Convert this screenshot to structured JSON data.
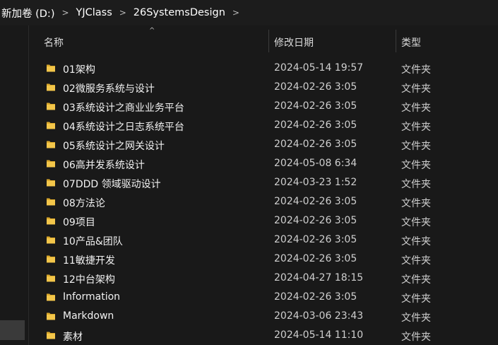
{
  "breadcrumb": {
    "items": [
      "新加卷 (D:)",
      "YJClass",
      "26SystemsDesign"
    ],
    "separator": ">"
  },
  "columns": {
    "name": "名称",
    "date": "修改日期",
    "type": "类型",
    "sort_indicator": "^"
  },
  "colors": {
    "background": "#191919",
    "folder_yellow": "#f0c040",
    "text": "#f2f2f2"
  },
  "files": [
    {
      "name": "01架构",
      "date": "2024-05-14 19:57",
      "type": "文件夹",
      "icon": "folder-icon"
    },
    {
      "name": "02微服务系统与设计",
      "date": "2024-02-26 3:05",
      "type": "文件夹",
      "icon": "folder-icon"
    },
    {
      "name": "03系统设计之商业业务平台",
      "date": "2024-02-26 3:05",
      "type": "文件夹",
      "icon": "folder-icon"
    },
    {
      "name": "04系统设计之日志系统平台",
      "date": "2024-02-26 3:05",
      "type": "文件夹",
      "icon": "folder-icon"
    },
    {
      "name": "05系统设计之网关设计",
      "date": "2024-02-26 3:05",
      "type": "文件夹",
      "icon": "folder-icon"
    },
    {
      "name": "06高并发系统设计",
      "date": "2024-05-08 6:34",
      "type": "文件夹",
      "icon": "folder-icon"
    },
    {
      "name": "07DDD 领域驱动设计",
      "date": "2024-03-23 1:52",
      "type": "文件夹",
      "icon": "folder-icon"
    },
    {
      "name": "08方法论",
      "date": "2024-02-26 3:05",
      "type": "文件夹",
      "icon": "folder-icon"
    },
    {
      "name": "09项目",
      "date": "2024-02-26 3:05",
      "type": "文件夹",
      "icon": "folder-icon"
    },
    {
      "name": "10产品&团队",
      "date": "2024-02-26 3:05",
      "type": "文件夹",
      "icon": "folder-icon"
    },
    {
      "name": "11敏捷开发",
      "date": "2024-02-26 3:05",
      "type": "文件夹",
      "icon": "folder-icon"
    },
    {
      "name": "12中台架构",
      "date": "2024-04-27 18:15",
      "type": "文件夹",
      "icon": "folder-icon"
    },
    {
      "name": "Information",
      "date": "2024-02-26 3:05",
      "type": "文件夹",
      "icon": "folder-icon"
    },
    {
      "name": "Markdown",
      "date": "2024-03-06 23:43",
      "type": "文件夹",
      "icon": "folder-icon"
    },
    {
      "name": "素材",
      "date": "2024-05-14 11:10",
      "type": "文件夹",
      "icon": "folder-icon"
    }
  ]
}
